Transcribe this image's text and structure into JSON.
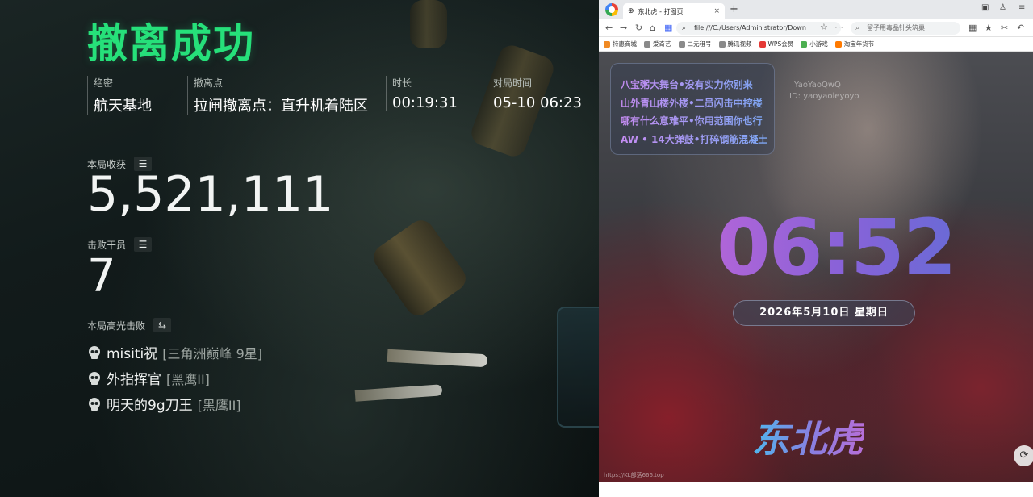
{
  "game": {
    "title": "撤离成功",
    "info": [
      {
        "label": "绝密",
        "value": "航天基地"
      },
      {
        "label": "撤离点",
        "value": "拉闸撤离点：直升机着陆区"
      },
      {
        "label": "时长",
        "value": "00:19:31"
      },
      {
        "label": "对局时间",
        "value": "05-10 06:23"
      }
    ],
    "income": {
      "label": "本局收获",
      "value": "5,521,111",
      "icon": "list-icon"
    },
    "kills": {
      "label": "击败干员",
      "value": "7",
      "icon": "list-icon"
    },
    "highlights": {
      "label": "本局高光击败",
      "icon": "swap-icon",
      "items": [
        {
          "name": "misiti祝",
          "rank": "[三角洲巅峰 9星]"
        },
        {
          "name": "外指挥官",
          "rank": "[黑鹰II]"
        },
        {
          "name": "明天的9g刀王",
          "rank": "[黑鹰II]"
        }
      ]
    },
    "accent_color": "#26e07a"
  },
  "browser": {
    "tab_title": "东北虎 - 打图页",
    "tab_close": "×",
    "new_tab": "+",
    "url": "file:///C:/Users/Administrator/Down",
    "search_placeholder": "留子用毒品针头筑巢",
    "bookmarks": [
      {
        "label": "特惠商城",
        "color": "#f08a24"
      },
      {
        "label": "爱奇艺",
        "color": "#8a8a8a"
      },
      {
        "label": "二元租号",
        "color": "#8a8a8a"
      },
      {
        "label": "腾讯视频",
        "color": "#8a8a8a"
      },
      {
        "label": "WPS会员",
        "color": "#e53935"
      },
      {
        "label": "小游戏",
        "color": "#4caf50"
      },
      {
        "label": "淘宝年货节",
        "color": "#ff7a00"
      }
    ]
  },
  "page": {
    "notice_lines": [
      "八宝粥大舞台•没有实力你别来",
      "山外青山楼外楼•二员闪击中控楼",
      "哪有什么意难平•你用范围你也行",
      "AW • 14大弹鼓•打碎钢筋混凝土"
    ],
    "watermark": [
      "YaoYaoQwQ",
      "ID: yaoyaoleyoyo"
    ],
    "clock": "06:52",
    "date": "2026年5月10日 星期日",
    "brand": "东北虎",
    "site_url": "https://KL部落666.top",
    "refresh_icon": "⟳"
  }
}
